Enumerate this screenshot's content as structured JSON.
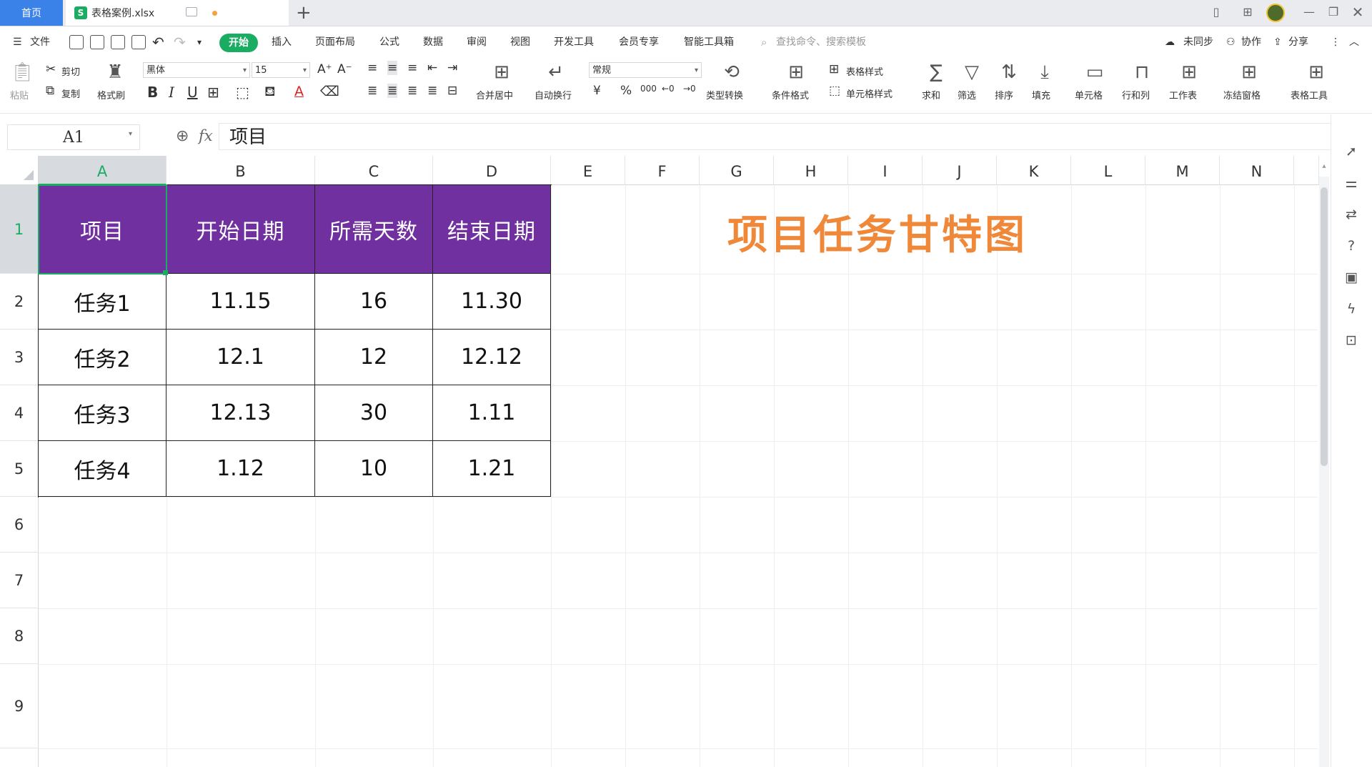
{
  "tabs": {
    "home": "首页",
    "file_icon": "S",
    "file_name": "表格案例.xlsx",
    "add": "+"
  },
  "menu": {
    "file": "文件",
    "items": [
      "开始",
      "插入",
      "页面布局",
      "公式",
      "数据",
      "审阅",
      "视图",
      "开发工具",
      "会员专享",
      "智能工具箱"
    ],
    "search_placeholder": "查找命令、搜索模板",
    "unsynced": "未同步",
    "collab": "协作",
    "share": "分享"
  },
  "ribbon": {
    "paste": "粘贴",
    "cut": "剪切",
    "copy": "复制",
    "format_painter": "格式刷",
    "font_name": "黑体",
    "font_size": "15",
    "bold": "B",
    "italic": "I",
    "underline": "U",
    "merge_center": "合并居中",
    "wrap_text": "自动换行",
    "number_format": "常规",
    "type_convert": "类型转换",
    "cond_format": "条件格式",
    "table_style": "表格样式",
    "cell_style": "单元格样式",
    "sum": "求和",
    "filter": "筛选",
    "sort": "排序",
    "fill": "填充",
    "cell": "单元格",
    "row_col": "行和列",
    "worksheet": "工作表",
    "freeze": "冻结窗格",
    "table_tools": "表格工具"
  },
  "formula_bar": {
    "name_box": "A1",
    "fx": "fx",
    "content": "项目"
  },
  "columns": [
    "A",
    "B",
    "C",
    "D",
    "E",
    "F",
    "G",
    "H",
    "I",
    "J",
    "K",
    "L",
    "M",
    "N"
  ],
  "rows": [
    "1",
    "2",
    "3",
    "4",
    "5",
    "6",
    "7",
    "8",
    "9"
  ],
  "table": {
    "headers": [
      "项目",
      "开始日期",
      "所需天数",
      "结束日期"
    ],
    "rows": [
      [
        "任务1",
        "11.15",
        "16",
        "11.30"
      ],
      [
        "任务2",
        "12.1",
        "12",
        "12.12"
      ],
      [
        "任务3",
        "12.13",
        "30",
        "1.11"
      ],
      [
        "任务4",
        "1.12",
        "10",
        "1.21"
      ]
    ]
  },
  "sheet_title": "项目任务甘特图",
  "colors": {
    "accent": "#1aad62",
    "tab_home": "#3b82e8",
    "header_fill": "#7030a0",
    "title": "#f0883a"
  }
}
